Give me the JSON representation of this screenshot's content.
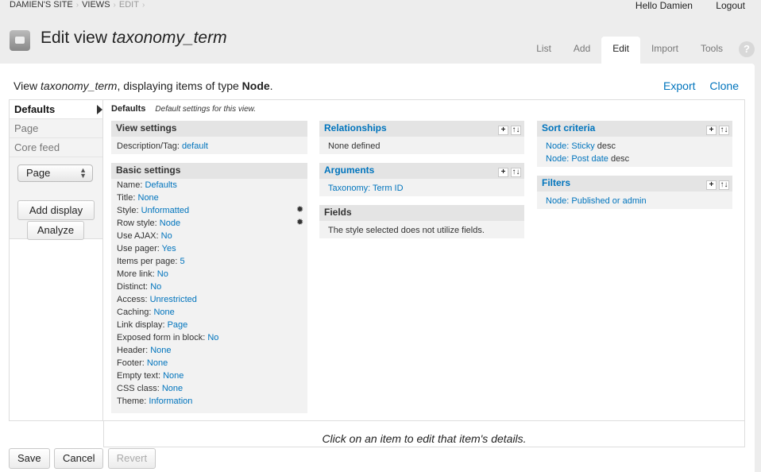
{
  "breadcrumb": [
    "DAMIEN'S SITE",
    "VIEWS",
    "EDIT"
  ],
  "usernav": {
    "greeting": "Hello Damien",
    "logout": "Logout"
  },
  "page": {
    "title_prefix": "Edit view ",
    "view_name": "taxonomy_term"
  },
  "tabs": [
    {
      "label": "List"
    },
    {
      "label": "Add"
    },
    {
      "label": "Edit"
    },
    {
      "label": "Import"
    },
    {
      "label": "Tools"
    }
  ],
  "help_label": "?",
  "description": {
    "prefix": "View ",
    "view_name": "taxonomy_term",
    "middle": ", displaying items of type ",
    "type": "Node",
    "suffix": "."
  },
  "view_actions": {
    "export": "Export",
    "clone": "Clone"
  },
  "displays": [
    "Defaults",
    "Page",
    "Core feed"
  ],
  "display_select": {
    "value": "Page"
  },
  "buttons": {
    "add_display": "Add display",
    "analyze": "Analyze",
    "save": "Save",
    "cancel": "Cancel",
    "revert": "Revert"
  },
  "defaults_heading": {
    "title": "Defaults",
    "subtitle": "Default settings for this view."
  },
  "view_settings": {
    "title": "View settings",
    "rows": [
      {
        "label": "Description/Tag: ",
        "value": "default"
      }
    ]
  },
  "basic_settings": {
    "title": "Basic settings",
    "rows": [
      {
        "label": "Name: ",
        "value": "Defaults"
      },
      {
        "label": "Title: ",
        "value": "None"
      },
      {
        "label": "Style: ",
        "value": "Unformatted"
      },
      {
        "label": "Row style: ",
        "value": "Node"
      },
      {
        "label": "Use AJAX: ",
        "value": "No"
      },
      {
        "label": "Use pager: ",
        "value": "Yes"
      },
      {
        "label": "Items per page: ",
        "value": "5"
      },
      {
        "label": "More link: ",
        "value": "No"
      },
      {
        "label": "Distinct: ",
        "value": "No"
      },
      {
        "label": "Access: ",
        "value": "Unrestricted"
      },
      {
        "label": "Caching: ",
        "value": "None"
      },
      {
        "label": "Link display: ",
        "value": "Page"
      },
      {
        "label": "Exposed form in block: ",
        "value": "No"
      },
      {
        "label": "Header: ",
        "value": "None"
      },
      {
        "label": "Footer: ",
        "value": "None"
      },
      {
        "label": "Empty text: ",
        "value": "None"
      },
      {
        "label": "CSS class: ",
        "value": "None"
      },
      {
        "label": "Theme: ",
        "value": "Information"
      }
    ]
  },
  "relationships": {
    "title": "Relationships",
    "empty": "None defined"
  },
  "arguments": {
    "title": "Arguments",
    "item": "Taxonomy: Term ID"
  },
  "fields": {
    "title": "Fields",
    "note": "The style selected does not utilize fields."
  },
  "sort_criteria": {
    "title": "Sort criteria",
    "rows": [
      {
        "link": "Node: Sticky",
        "rest": " desc"
      },
      {
        "link": "Node: Post date",
        "rest": " desc"
      }
    ]
  },
  "filters": {
    "title": "Filters",
    "item": "Node: Published or admin"
  },
  "footer_message": "Click on an item to edit that item's details.",
  "icons": {
    "add": "+",
    "rearrange": "↑↓",
    "gear": "✹"
  }
}
